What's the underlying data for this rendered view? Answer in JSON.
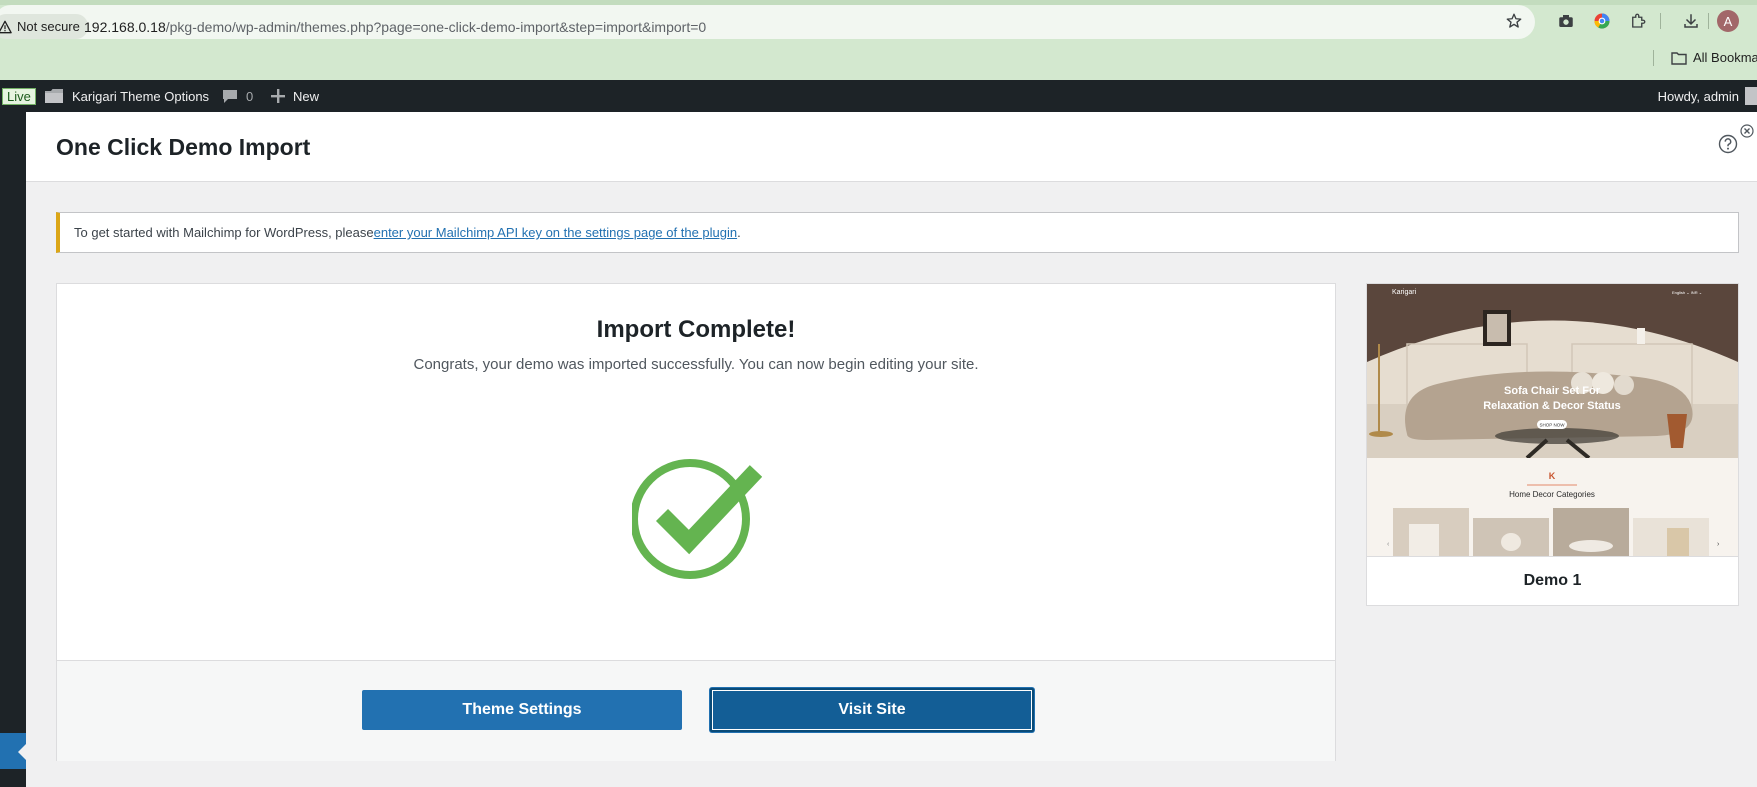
{
  "browser": {
    "security_label": "Not secure",
    "url_host": "192.168.0.18",
    "url_path": "/pkg-demo/wp-admin/themes.php?page=one-click-demo-import&step=import&import=0",
    "profile_initial": "A",
    "bookmarks_label": "All Bookma"
  },
  "adminbar": {
    "live_label": "Live",
    "theme_options_label": "Karigari Theme Options",
    "comments_count": "0",
    "new_label": "New",
    "howdy_label": "Howdy, admin"
  },
  "page": {
    "title": "One Click Demo Import"
  },
  "notice": {
    "text": "To get started with Mailchimp for WordPress, please ",
    "link_text": "enter your Mailchimp API key on the settings page of the plugin",
    "suffix": "."
  },
  "import": {
    "heading": "Import Complete!",
    "message": "Congrats, your demo was imported successfully. You can now begin editing your site.",
    "theme_settings_label": "Theme Settings",
    "visit_site_label": "Visit Site"
  },
  "demo": {
    "name": "Demo 1",
    "preview": {
      "brand": "Karigari",
      "hero_line1": "Sofa Chair Set For",
      "hero_line2": "Relaxation & Decor Status",
      "hero_button": "SHOP NOW",
      "section_title": "Home Decor Categories"
    }
  },
  "colors": {
    "wp_blue": "#2271b1",
    "wp_blue_dark": "#135e96",
    "check_green": "#64b450",
    "notice_border": "#dba617",
    "adminbar": "#1d2327"
  }
}
